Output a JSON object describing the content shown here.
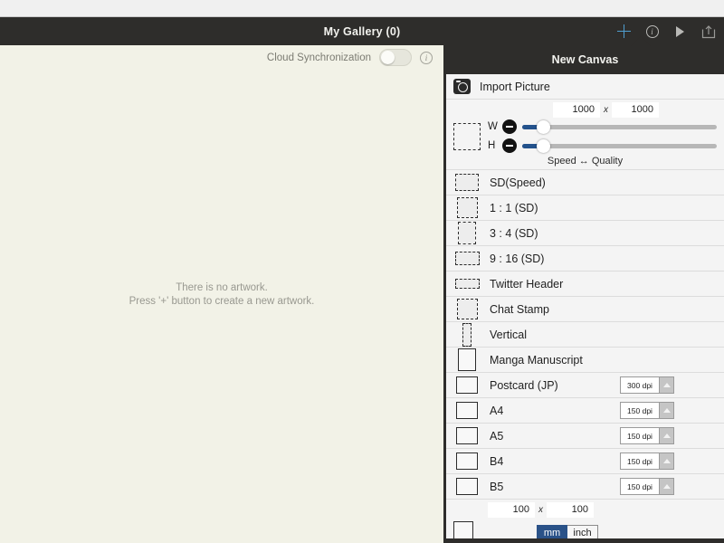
{
  "titlebar": {
    "title": "My Gallery (0)",
    "actions": [
      {
        "name": "add-artwork-button",
        "icon": "plus-icon",
        "label": "+"
      },
      {
        "name": "info-button",
        "icon": "info-icon",
        "label": "i"
      },
      {
        "name": "play-button",
        "icon": "play-icon",
        "label": ""
      },
      {
        "name": "share-button",
        "icon": "share-icon",
        "label": ""
      }
    ]
  },
  "gallery": {
    "cloud_sync_label": "Cloud Synchronization",
    "cloud_sync_state": "off",
    "empty_line1": "There is no artwork.",
    "empty_line2": "Press '+' button to create a new artwork."
  },
  "panel": {
    "header": "New Canvas",
    "import_label": "Import Picture",
    "size": {
      "width": "1000",
      "separator": "x",
      "height": "1000"
    },
    "sliders": {
      "width_label": "W",
      "height_label": "H",
      "minus_label": "−",
      "quality_label": "Speed ↔ Quality"
    },
    "presets": [
      {
        "label": "SD(Speed)",
        "shape": "wide",
        "style": "dashed",
        "dpi": ""
      },
      {
        "label": "1 : 1 (SD)",
        "shape": "square",
        "style": "dashed",
        "dpi": ""
      },
      {
        "label": "3 : 4 (SD)",
        "shape": "portrait",
        "style": "dashed",
        "dpi": ""
      },
      {
        "label": "9 : 16 (SD)",
        "shape": "wide2",
        "style": "dashed",
        "dpi": ""
      },
      {
        "label": "Twitter Header",
        "shape": "banner",
        "style": "dashed",
        "dpi": ""
      },
      {
        "label": "Chat Stamp",
        "shape": "square",
        "style": "dashed",
        "dpi": ""
      },
      {
        "label": "Vertical",
        "shape": "narrow",
        "style": "dashed",
        "dpi": ""
      },
      {
        "label": "Manga Manuscript",
        "shape": "portrait",
        "style": "solid",
        "dpi": ""
      },
      {
        "label": "Postcard (JP)",
        "shape": "paper",
        "style": "solid",
        "dpi": "300 dpi"
      },
      {
        "label": "A4",
        "shape": "paper",
        "style": "solid",
        "dpi": "150 dpi"
      },
      {
        "label": "A5",
        "shape": "paper",
        "style": "solid",
        "dpi": "150 dpi"
      },
      {
        "label": "B4",
        "shape": "paper",
        "style": "solid",
        "dpi": "150 dpi"
      },
      {
        "label": "B5",
        "shape": "paper",
        "style": "solid",
        "dpi": "150 dpi"
      }
    ],
    "custom": {
      "width": "100",
      "separator": "x",
      "height": "100",
      "unit_selected": "mm",
      "unit_other": "inch"
    }
  },
  "colors": {
    "dark_bar": "#2e2d2b",
    "gallery_bg": "#f2f2e7",
    "panel_bg": "#f4f4f4",
    "accent_blue": "#4f9ed0",
    "slider_blue": "#23528c",
    "unit_active": "#2a5288"
  }
}
